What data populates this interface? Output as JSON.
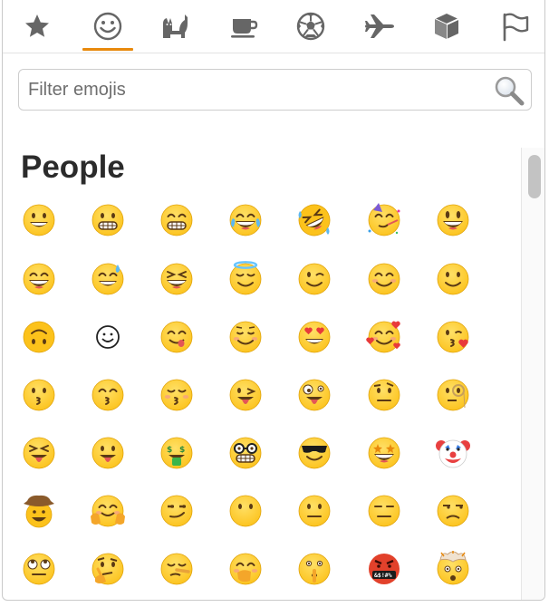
{
  "tabs": [
    {
      "icon": "star-icon",
      "name": "tab-frequently-used"
    },
    {
      "icon": "smiley-icon",
      "name": "tab-people",
      "active": true
    },
    {
      "icon": "cat-icon",
      "name": "tab-animals"
    },
    {
      "icon": "coffee-cup-icon",
      "name": "tab-food"
    },
    {
      "icon": "soccer-ball-icon",
      "name": "tab-activities"
    },
    {
      "icon": "airplane-icon",
      "name": "tab-travel"
    },
    {
      "icon": "cube-icon",
      "name": "tab-objects"
    },
    {
      "icon": "flag-icon",
      "name": "tab-flags"
    }
  ],
  "colors": {
    "accent": "#e8890c",
    "emoji_face": "#fcc21b",
    "icon_gray": "#666666"
  },
  "search": {
    "placeholder": "Filter emojis",
    "value": ""
  },
  "section": {
    "title": "People"
  },
  "emojis": [
    [
      "😀",
      "😬",
      "😁",
      "😂",
      "🤣",
      "🥳",
      "😃"
    ],
    [
      "😄",
      "😅",
      "😆",
      "😇",
      "😉",
      "😊",
      "🙂"
    ],
    [
      "🙃",
      "☺",
      "😋",
      "😌",
      "😍",
      "🥰",
      "😘"
    ],
    [
      "😗",
      "😙",
      "😚",
      "😜",
      "🤪",
      "🤨",
      "🧐"
    ],
    [
      "😝",
      "😛",
      "🤑",
      "🤓",
      "😎",
      "🤩",
      "🤡"
    ],
    [
      "🤠",
      "🤗",
      "😏",
      "😶",
      "😐",
      "😑",
      "😒"
    ],
    [
      "🙄",
      "🤔",
      "🤥",
      "🤭",
      "🤫",
      "🤬",
      "🤯"
    ]
  ]
}
